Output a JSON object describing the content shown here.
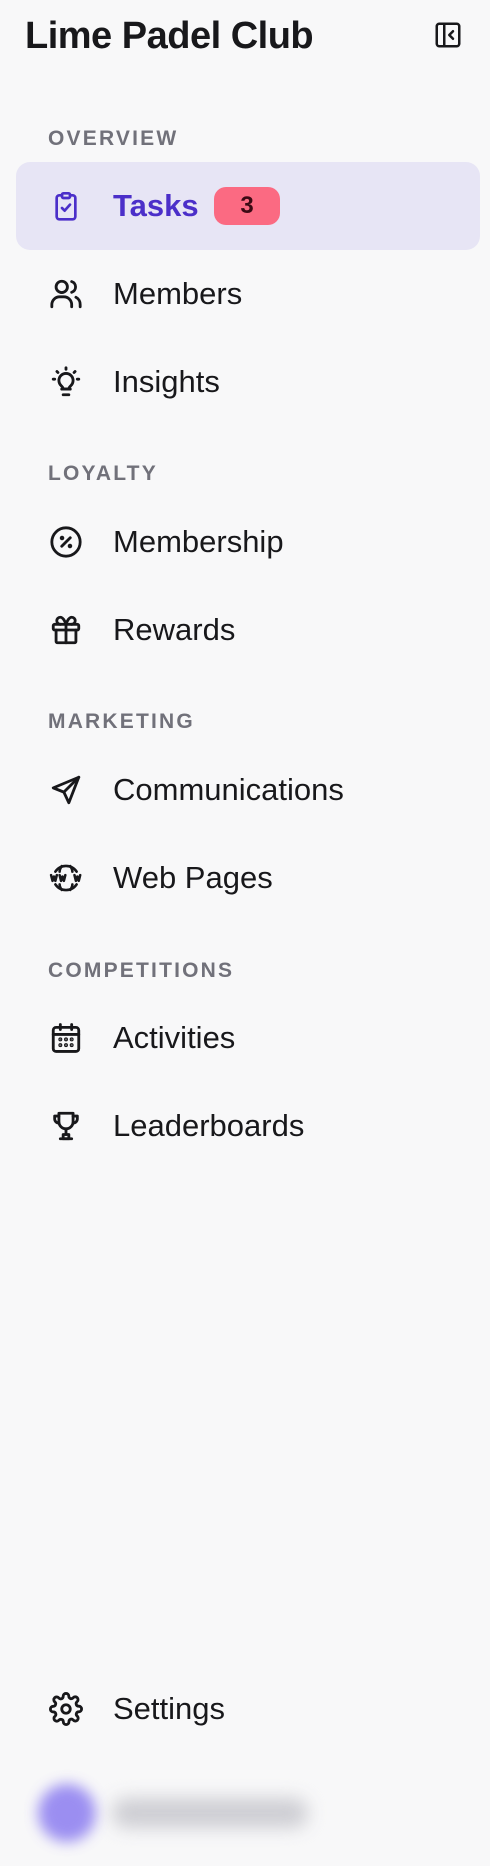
{
  "app": {
    "title": "Lime Padel Club"
  },
  "sections": {
    "overview": "OVERVIEW",
    "loyalty": "LOYALTY",
    "marketing": "MARKETING",
    "competitions": "COMPETITIONS"
  },
  "nav": {
    "tasks": {
      "label": "Tasks",
      "icon": "clipboard-check-icon",
      "badge": "3",
      "active": true
    },
    "members": {
      "label": "Members",
      "icon": "users-icon"
    },
    "insights": {
      "label": "Insights",
      "icon": "lightbulb-icon"
    },
    "membership": {
      "label": "Membership",
      "icon": "percent-circle-icon"
    },
    "rewards": {
      "label": "Rewards",
      "icon": "gift-icon"
    },
    "communications": {
      "label": "Communications",
      "icon": "send-icon"
    },
    "web_pages": {
      "label": "Web Pages",
      "icon": "globe-www-icon"
    },
    "activities": {
      "label": "Activities",
      "icon": "calendar-icon"
    },
    "leaderboards": {
      "label": "Leaderboards",
      "icon": "trophy-icon"
    },
    "settings": {
      "label": "Settings",
      "icon": "gear-icon"
    }
  },
  "colors": {
    "background": "#f8f8f9",
    "active_bg": "#e7e5f5",
    "accent": "#4b2fc9",
    "badge_bg": "#fb6a82",
    "section_label": "#71717a",
    "text": "#18181b"
  }
}
